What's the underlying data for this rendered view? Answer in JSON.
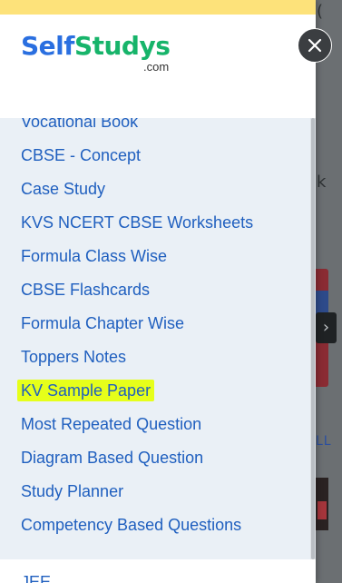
{
  "logo": {
    "part1": "Self",
    "part2": "Studys",
    "domain": ".com"
  },
  "menu": {
    "items": [
      "Vocational Book",
      "CBSE - Concept",
      "Case Study",
      "KVS NCERT CBSE Worksheets",
      "Formula Class Wise",
      "CBSE Flashcards",
      "Formula Chapter Wise",
      "Toppers Notes",
      "KV Sample Paper",
      "Most Repeated Question",
      "Diagram Based Question",
      "Study Planner",
      "Competency Based Questions"
    ],
    "highlighted_item": "KV Sample Paper"
  },
  "next_section_peek": "JEE",
  "background": {
    "visible_fragment_k": "k",
    "visible_fragment_ll": "LL",
    "arrow_glyph": "›"
  },
  "colors": {
    "link": "#1f5fbf",
    "logo_blue": "#2a6fe0",
    "logo_green": "#17b46a",
    "highlight": "#e6ff1a",
    "top_strip": "#fde27a",
    "drawer_bg": "#eaf0f6"
  },
  "icons": {
    "close": "close-icon",
    "arrow": "chevron-right-icon"
  }
}
